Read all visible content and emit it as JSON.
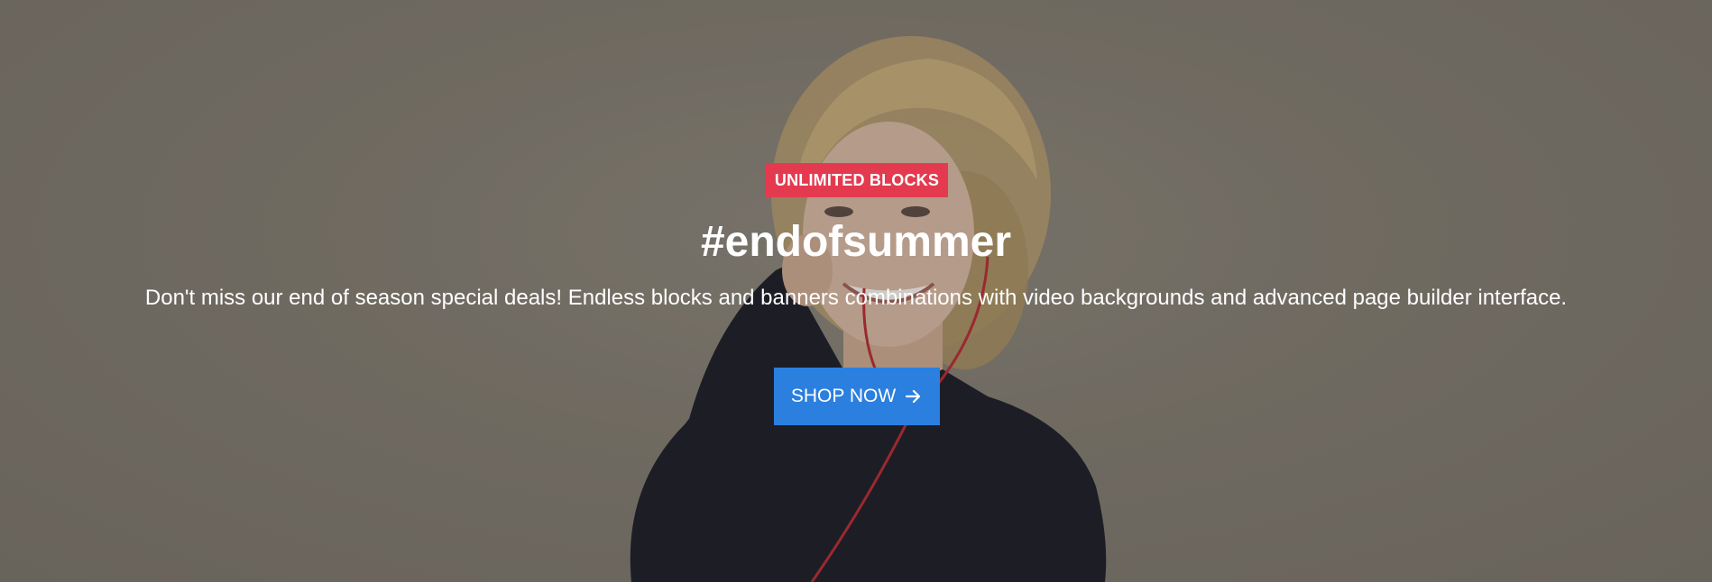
{
  "hero": {
    "badge": "UNLIMITED BLOCKS",
    "title": "#endofsummer",
    "subtitle": "Don't miss our end of season special deals! Endless blocks and banners combinations with video backgrounds and advanced page builder interface.",
    "cta_label": "SHOP NOW",
    "cta_icon": "arrow-right-icon",
    "colors": {
      "badge_bg": "#e43a4f",
      "cta_bg": "#2b7fdf",
      "text": "#ffffff"
    }
  }
}
